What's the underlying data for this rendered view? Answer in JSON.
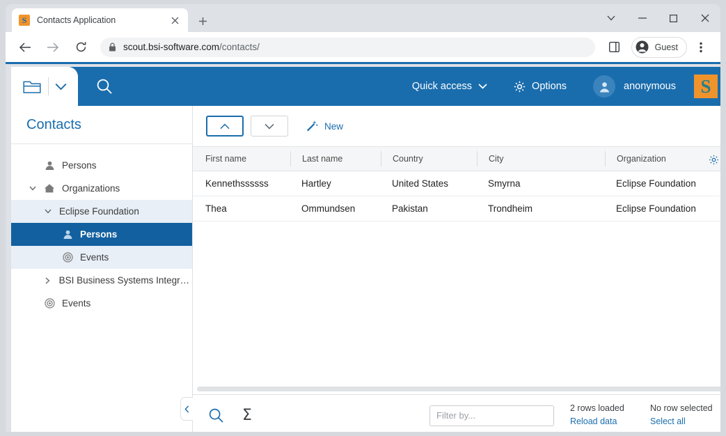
{
  "browser": {
    "tab": {
      "title": "Contacts Application",
      "favicon_letter": "S",
      "favicon_name": "scout-favicon",
      "close_label": "×"
    },
    "new_tab_label": "+",
    "window_controls": {
      "tab_search": "⌄",
      "minimize": "—",
      "maximize": "□",
      "close": "✕"
    },
    "nav": {
      "back": "←",
      "forward": "→",
      "reload": "⟳"
    },
    "omnibox": {
      "domain": "scout.bsi-software.com",
      "path": "/contacts/",
      "lock_icon": "lock-icon"
    },
    "side_panel_icon": "side-panel-icon",
    "profile": {
      "label": "Guest"
    },
    "menu_icon": "three-dot-menu-icon"
  },
  "app_header": {
    "view_tab": {
      "folder_icon": "folder-icon",
      "chevron_icon": "chevron-down-icon"
    },
    "search_icon": "search-icon",
    "quick_access": {
      "label": "Quick access",
      "chevron": "⌄"
    },
    "options": {
      "label": "Options",
      "icon": "gear-icon"
    },
    "user": {
      "name": "anonymous",
      "avatar_icon": "user-avatar-icon"
    },
    "logo": {
      "letter": "S",
      "name": "bsi-scout-logo"
    },
    "colors": {
      "header_bg": "#1a6dad",
      "accent": "#1a6dad",
      "logo_bg": "#f0932b",
      "logo_fg": "#2a7f8c",
      "selected_node_bg": "#12609f",
      "soft_node_bg": "#e8eff7"
    }
  },
  "sidebar": {
    "title": "Contacts",
    "collapse_handle": "‹",
    "items": [
      {
        "label": "Persons",
        "level": 1,
        "icon": "person-icon",
        "chevron": "",
        "state": "normal"
      },
      {
        "label": "Organizations",
        "level": 1,
        "icon": "home-icon",
        "chevron": "⌄",
        "state": "normal"
      },
      {
        "label": "Eclipse Foundation",
        "level": 2,
        "icon": "",
        "chevron": "⌄",
        "state": "soft"
      },
      {
        "label": "Persons",
        "level": 3,
        "icon": "person-icon",
        "chevron": "",
        "state": "selected"
      },
      {
        "label": "Events",
        "level": 3,
        "icon": "target-icon",
        "chevron": "",
        "state": "soft"
      },
      {
        "label": "BSI Business Systems Integra…",
        "level": 2,
        "icon": "",
        "chevron": "›",
        "state": "normal"
      },
      {
        "label": "Events",
        "level": 1,
        "icon": "target-icon",
        "chevron": "",
        "state": "normal"
      }
    ]
  },
  "content_toolbar": {
    "back_button": {
      "name": "collapse-up-button",
      "glyph": "⌃"
    },
    "forward_button": {
      "name": "expand-down-button",
      "glyph": "⌄"
    },
    "new_button": {
      "label": "New",
      "icon": "magic-wand-icon"
    }
  },
  "table": {
    "columns": [
      "First name",
      "Last name",
      "Country",
      "City",
      "Organization"
    ],
    "settings_icon": "gear-icon",
    "rows": [
      {
        "first_name": "Kennethssssss",
        "last_name": "Hartley",
        "country": "United States",
        "city": "Smyrna",
        "organization": "Eclipse Foundation"
      },
      {
        "first_name": "Thea",
        "last_name": "Ommundsen",
        "country": "Pakistan",
        "city": "Trondheim",
        "organization": "Eclipse Foundation"
      }
    ]
  },
  "status_bar": {
    "search_icon": "search-icon",
    "sum_icon": "sigma-icon",
    "sum_glyph": "Σ",
    "filter": {
      "placeholder": "Filter by...",
      "value": ""
    },
    "rows_loaded": "2 rows loaded",
    "reload_link": "Reload data",
    "selection": "No row selected",
    "select_all_link": "Select all"
  }
}
